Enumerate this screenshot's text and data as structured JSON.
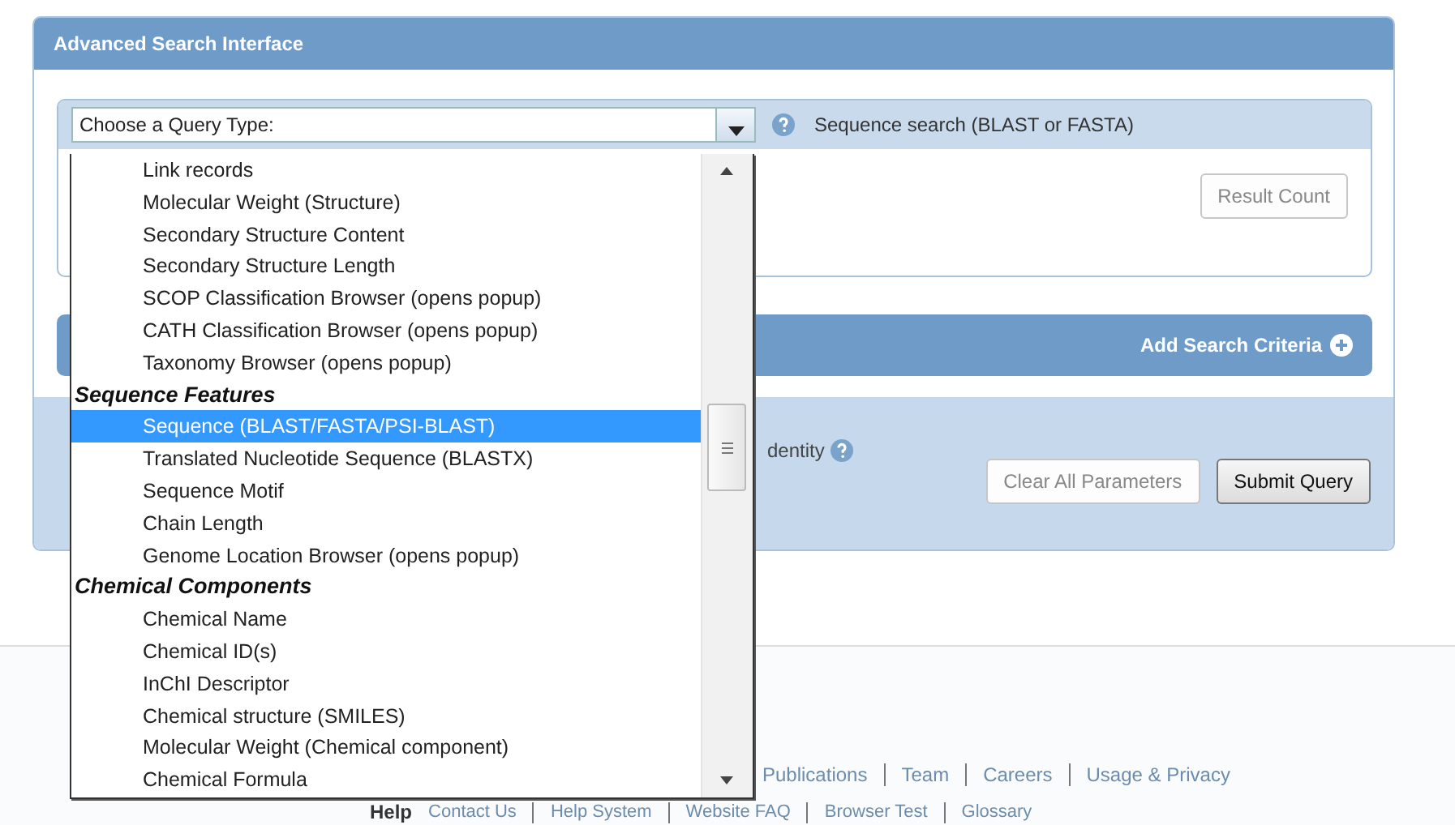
{
  "panel": {
    "title": "Advanced Search Interface"
  },
  "query": {
    "select_value": "Choose a Query Type:",
    "description": "Sequence search (BLAST or FASTA)",
    "result_button": "Result Count"
  },
  "add_criteria": "Add Search Criteria",
  "options_area": {
    "label": "dentity",
    "buttons": [
      {
        "label": "Clear All Parameters",
        "kind": "secondary"
      },
      {
        "label": "Submit Query",
        "kind": "primary"
      }
    ]
  },
  "dropdown": {
    "items": [
      {
        "kind": "option",
        "label": "Link records",
        "selected": false
      },
      {
        "kind": "option",
        "label": "Molecular Weight (Structure)",
        "selected": false
      },
      {
        "kind": "option",
        "label": "Secondary Structure Content",
        "selected": false
      },
      {
        "kind": "option",
        "label": "Secondary Structure Length",
        "selected": false
      },
      {
        "kind": "option",
        "label": "SCOP Classification Browser  (opens popup)",
        "selected": false
      },
      {
        "kind": "option",
        "label": "CATH Classification Browser  (opens popup)",
        "selected": false
      },
      {
        "kind": "option",
        "label": "Taxonomy Browser  (opens popup)",
        "selected": false
      },
      {
        "kind": "group",
        "label": "Sequence Features",
        "selected": false
      },
      {
        "kind": "option",
        "label": "Sequence (BLAST/FASTA/PSI-BLAST)",
        "selected": true
      },
      {
        "kind": "option",
        "label": "Translated Nucleotide Sequence (BLASTX)",
        "selected": false
      },
      {
        "kind": "option",
        "label": "Sequence Motif",
        "selected": false
      },
      {
        "kind": "option",
        "label": "Chain Length",
        "selected": false
      },
      {
        "kind": "option",
        "label": "Genome Location Browser  (opens popup)",
        "selected": false
      },
      {
        "kind": "group",
        "label": "Chemical Components",
        "selected": false
      },
      {
        "kind": "option",
        "label": "Chemical Name",
        "selected": false
      },
      {
        "kind": "option",
        "label": "Chemical ID(s)",
        "selected": false
      },
      {
        "kind": "option",
        "label": "InChI Descriptor",
        "selected": false
      },
      {
        "kind": "option",
        "label": "Chemical structure (SMILES)",
        "selected": false
      },
      {
        "kind": "option",
        "label": "Molecular Weight (Chemical component)",
        "selected": false
      },
      {
        "kind": "option",
        "label": "Chemical Formula",
        "selected": false
      }
    ]
  },
  "footer": {
    "links": [
      "Publications",
      "Team",
      "Careers",
      "Usage & Privacy"
    ],
    "help_heading": "Help",
    "help_links": [
      "Contact Us",
      "Help System",
      "Website FAQ",
      "Browser Test",
      "Glossary"
    ]
  }
}
